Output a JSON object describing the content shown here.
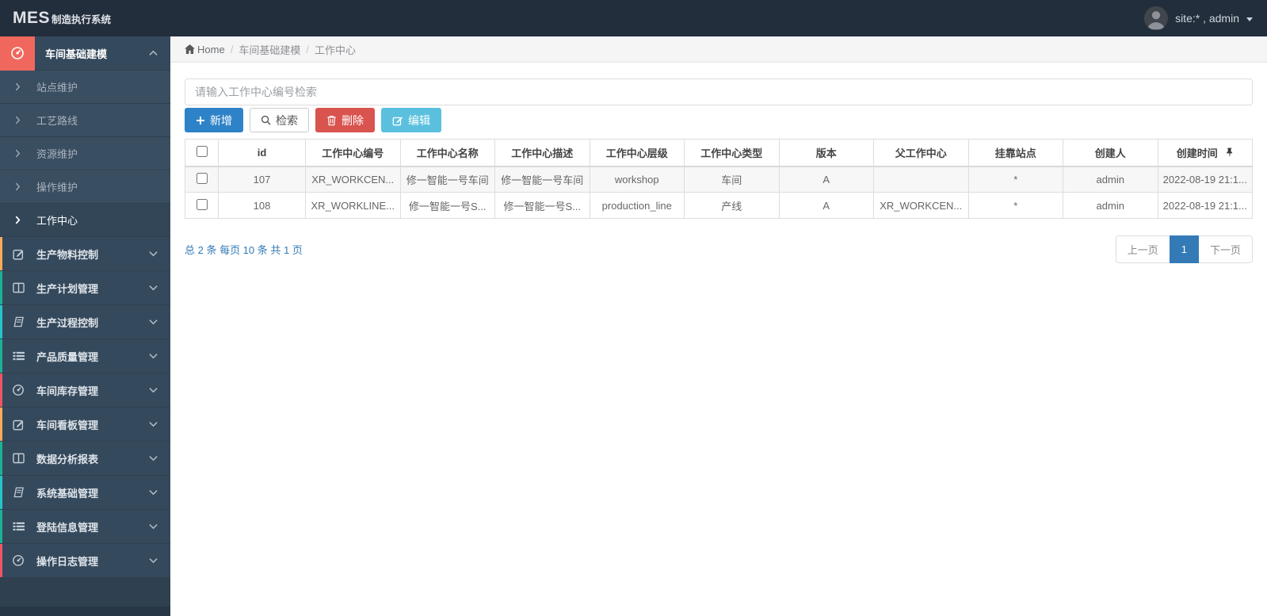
{
  "topbar": {
    "logo_mes": "MES",
    "logo_suffix": "制造执行系统",
    "user_label": "site:* , admin"
  },
  "breadcrumb": {
    "home": "Home",
    "sep": "/",
    "section": "车间基础建模",
    "current": "工作中心"
  },
  "sidebar": {
    "parent": {
      "label": "车间基础建模",
      "accent": "#f0685d"
    },
    "sub_items": [
      {
        "label": "站点维护"
      },
      {
        "label": "工艺路线"
      },
      {
        "label": "资源维护"
      },
      {
        "label": "操作维护"
      },
      {
        "label": "工作中心"
      }
    ],
    "items": [
      {
        "label": "生产物料控制",
        "strip": "#f8ac59"
      },
      {
        "label": "生产计划管理",
        "strip": "#1ab394"
      },
      {
        "label": "生产过程控制",
        "strip": "#23c6c8"
      },
      {
        "label": "产品质量管理",
        "strip": "#1ab394"
      },
      {
        "label": "车间库存管理",
        "strip": "#ed5565"
      },
      {
        "label": "车间看板管理",
        "strip": "#f8ac59"
      },
      {
        "label": "数据分析报表",
        "strip": "#1ab394"
      },
      {
        "label": "系统基础管理",
        "strip": "#23c6c8"
      },
      {
        "label": "登陆信息管理",
        "strip": "#1ab394"
      },
      {
        "label": "操作日志管理",
        "strip": "#ed5565"
      }
    ]
  },
  "search": {
    "placeholder": "请输入工作中心编号检索"
  },
  "toolbar": {
    "add_label": "新增",
    "search_label": "检索",
    "delete_label": "删除",
    "edit_label": "编辑",
    "colors": {
      "add": "#2e83c8",
      "delete": "#d9534f",
      "edit": "#5bc0de"
    }
  },
  "table": {
    "headers": [
      "id",
      "工作中心编号",
      "工作中心名称",
      "工作中心描述",
      "工作中心层级",
      "工作中心类型",
      "版本",
      "父工作中心",
      "挂靠站点",
      "创建人",
      "创建时间"
    ],
    "rows": [
      {
        "id": "107",
        "code": "XR_WORKCEN...",
        "name": "修一智能一号车间",
        "desc": "修一智能一号车间",
        "level": "workshop",
        "type": "车间",
        "version": "A",
        "parent": "",
        "station": "*",
        "creator": "admin",
        "created": "2022-08-19 21:1..."
      },
      {
        "id": "108",
        "code": "XR_WORKLINE...",
        "name": "修一智能一号S...",
        "desc": "修一智能一号S...",
        "level": "production_line",
        "type": "产线",
        "version": "A",
        "parent": "XR_WORKCEN...",
        "station": "*",
        "creator": "admin",
        "created": "2022-08-19 21:1..."
      }
    ]
  },
  "pagination": {
    "summary": "总 2 条 每页 10 条 共 1 页",
    "prev_label": "上一页",
    "current_page": "1",
    "next_label": "下一页",
    "active_color": "#337ab7"
  }
}
